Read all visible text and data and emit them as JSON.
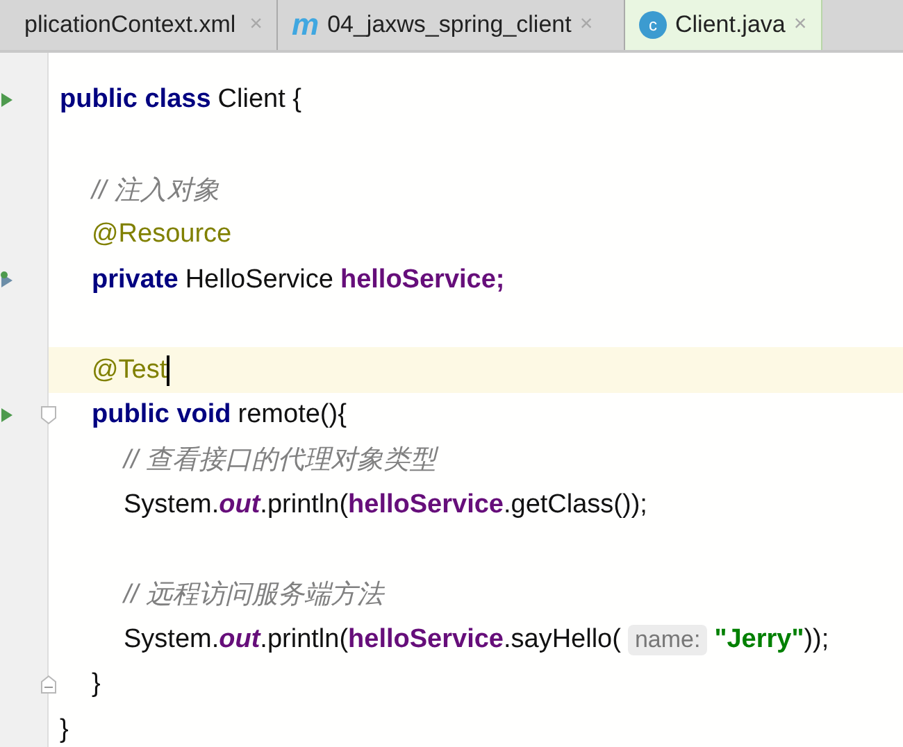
{
  "tabs": [
    {
      "label": "plicationContext.xml",
      "kind": "xml",
      "selected": false,
      "close": "×"
    },
    {
      "label": "04_jaxws_spring_client",
      "kind": "module",
      "selected": false,
      "close": "×"
    },
    {
      "label": "Client.java",
      "kind": "class",
      "selected": true,
      "close": "×"
    }
  ],
  "module_icon_text": "m",
  "class_icon_text": "c",
  "code": [
    {
      "markers": [
        {
          "kind": "run"
        }
      ],
      "tokens": [
        {
          "kind": "keyword",
          "text": "public class"
        },
        {
          "kind": "plain",
          "text": "Client {"
        }
      ],
      "children": [
        {
          "blank_line_before": true,
          "tokens": [
            {
              "kind": "comment",
              "text": "// 注入对象"
            }
          ]
        },
        {
          "tokens": [
            {
              "kind": "annotation",
              "text": "@Resource"
            }
          ]
        },
        {
          "markers": [
            {
              "kind": "implemented"
            }
          ],
          "tokens": [
            {
              "kind": "keyword",
              "text": "private"
            },
            {
              "kind": "plain",
              "text": "HelloService"
            },
            {
              "kind": "field",
              "text": "helloService;"
            }
          ]
        },
        {
          "blank_line_before": true,
          "current": true,
          "caret": true,
          "tokens": [
            {
              "kind": "annotation",
              "text": "@Test"
            }
          ]
        },
        {
          "markers": [
            {
              "kind": "run"
            },
            {
              "kind": "fold-start"
            }
          ],
          "tokens": [
            {
              "kind": "keyword",
              "text": "public void"
            },
            {
              "kind": "plain",
              "text": "remote(){"
            }
          ],
          "children": [
            {
              "tokens": [
                {
                  "kind": "comment",
                  "text": "// 查看接口的代理对象类型"
                }
              ]
            },
            {
              "tokens": [
                {
                  "kind": "plain",
                  "text": "System."
                },
                {
                  "kind": "static",
                  "text": "out"
                },
                {
                  "kind": "plain",
                  "text": ".println("
                },
                {
                  "kind": "field",
                  "text": "helloService"
                },
                {
                  "kind": "plain",
                  "text": ".getClass());"
                }
              ]
            },
            {
              "blank_line_before": true,
              "tokens": [
                {
                  "kind": "comment",
                  "text": "// 远程访问服务端方法"
                }
              ]
            },
            {
              "tokens": [
                {
                  "kind": "plain",
                  "text": "System."
                },
                {
                  "kind": "static",
                  "text": "out"
                },
                {
                  "kind": "plain",
                  "text": ".println("
                },
                {
                  "kind": "field",
                  "text": "helloService"
                },
                {
                  "kind": "plain",
                  "text": ".sayHello("
                },
                {
                  "kind": "hint",
                  "text": "name:"
                },
                {
                  "kind": "string",
                  "text": "\"Jerry\""
                },
                {
                  "kind": "plain",
                  "text": "));"
                }
              ]
            }
          ]
        },
        {
          "markers": [
            {
              "kind": "fold-end"
            }
          ],
          "tokens": [
            {
              "kind": "plain",
              "text": "}"
            }
          ]
        }
      ]
    },
    {
      "tokens": [
        {
          "kind": "plain",
          "text": "}"
        }
      ]
    }
  ]
}
